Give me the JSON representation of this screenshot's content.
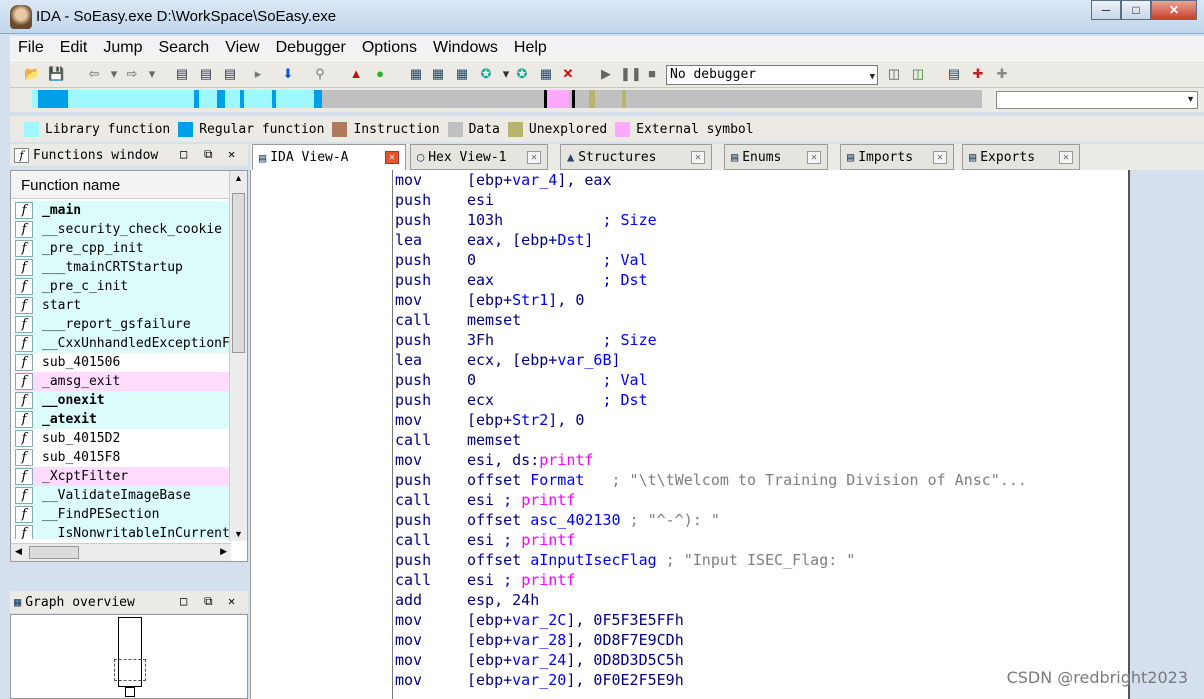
{
  "window": {
    "title": "IDA - SoEasy.exe D:\\WorkSpace\\SoEasy.exe"
  },
  "menu": [
    "File",
    "Edit",
    "Jump",
    "Search",
    "View",
    "Debugger",
    "Options",
    "Windows",
    "Help"
  ],
  "toolbar": {
    "debugger_value": "No debugger"
  },
  "legend": [
    {
      "label": "Library function",
      "color": "#9ff7ff"
    },
    {
      "label": "Regular function",
      "color": "#00a0e8"
    },
    {
      "label": "Instruction",
      "color": "#b07a5c"
    },
    {
      "label": "Data",
      "color": "#c0c0c0"
    },
    {
      "label": "Unexplored",
      "color": "#b8b46e"
    },
    {
      "label": "External symbol",
      "color": "#ffa8ff"
    }
  ],
  "functions_window": {
    "title": "Functions window",
    "column": "Function name",
    "items": [
      {
        "name": "_main",
        "bold": true,
        "bg": "#dcfcfc"
      },
      {
        "name": "__security_check_cookie",
        "bold": false,
        "bg": "#dcfcfc"
      },
      {
        "name": "_pre_cpp_init",
        "bold": false,
        "bg": "#dcfcfc"
      },
      {
        "name": "___tmainCRTStartup",
        "bold": false,
        "bg": "#dcfcfc"
      },
      {
        "name": "_pre_c_init",
        "bold": false,
        "bg": "#dcfcfc"
      },
      {
        "name": "start",
        "bold": false,
        "bg": "#dcfcfc"
      },
      {
        "name": "___report_gsfailure",
        "bold": false,
        "bg": "#dcfcfc"
      },
      {
        "name": "__CxxUnhandledExceptionFilter",
        "bold": false,
        "bg": "#dcfcfc"
      },
      {
        "name": "sub_401506",
        "bold": false,
        "bg": "#ffffff"
      },
      {
        "name": "_amsg_exit",
        "bold": false,
        "bg": "#ffdcff"
      },
      {
        "name": "__onexit",
        "bold": true,
        "bg": "#dcfcfc"
      },
      {
        "name": "_atexit",
        "bold": true,
        "bg": "#dcfcfc"
      },
      {
        "name": "sub_4015D2",
        "bold": false,
        "bg": "#ffffff"
      },
      {
        "name": "sub_4015F8",
        "bold": false,
        "bg": "#ffffff"
      },
      {
        "name": "_XcptFilter",
        "bold": false,
        "bg": "#ffdcff"
      },
      {
        "name": "__ValidateImageBase",
        "bold": false,
        "bg": "#dcfcfc"
      },
      {
        "name": "__FindPESection",
        "bold": false,
        "bg": "#dcfcfc"
      },
      {
        "name": "__IsNonwritableInCurrentImage",
        "bold": false,
        "bg": "#dcfcfc"
      }
    ]
  },
  "graph_overview": {
    "title": "Graph overview"
  },
  "tabs": [
    {
      "label": "IDA View-A",
      "active": true
    },
    {
      "label": "Hex View-1",
      "active": false
    },
    {
      "label": "Structures",
      "active": false
    },
    {
      "label": "Enums",
      "active": false
    },
    {
      "label": "Imports",
      "active": false
    },
    {
      "label": "Exports",
      "active": false
    }
  ],
  "disassembly": [
    {
      "mn": "mov",
      "op": [
        [
          "",
          "[ebp+"
        ],
        [
          "sym",
          "var_4"
        ],
        [
          "",
          "], eax"
        ]
      ]
    },
    {
      "mn": "push",
      "op": [
        [
          "",
          "esi"
        ]
      ]
    },
    {
      "mn": "push",
      "op": [
        [
          "",
          "103h           "
        ]
      ],
      "cm": "; Size"
    },
    {
      "mn": "lea",
      "op": [
        [
          "",
          "eax, [ebp+"
        ],
        [
          "sym",
          "Dst"
        ],
        [
          "",
          "]"
        ]
      ]
    },
    {
      "mn": "push",
      "op": [
        [
          "",
          "0              "
        ]
      ],
      "cm": "; Val"
    },
    {
      "mn": "push",
      "op": [
        [
          "",
          "eax            "
        ]
      ],
      "cm": "; Dst"
    },
    {
      "mn": "mov",
      "op": [
        [
          "",
          "[ebp+"
        ],
        [
          "sym",
          "Str1"
        ],
        [
          "",
          "], 0"
        ]
      ]
    },
    {
      "mn": "call",
      "op": [
        [
          "",
          "memset"
        ]
      ]
    },
    {
      "mn": "push",
      "op": [
        [
          "",
          "3Fh            "
        ]
      ],
      "cm": "; Size"
    },
    {
      "mn": "lea",
      "op": [
        [
          "",
          "ecx, [ebp+"
        ],
        [
          "sym",
          "var_6B"
        ],
        [
          "",
          "]"
        ]
      ]
    },
    {
      "mn": "push",
      "op": [
        [
          "",
          "0              "
        ]
      ],
      "cm": "; Val"
    },
    {
      "mn": "push",
      "op": [
        [
          "",
          "ecx            "
        ]
      ],
      "cm": "; Dst"
    },
    {
      "mn": "mov",
      "op": [
        [
          "",
          "[ebp+"
        ],
        [
          "sym",
          "Str2"
        ],
        [
          "",
          "], 0"
        ]
      ]
    },
    {
      "mn": "call",
      "op": [
        [
          "",
          "memset"
        ]
      ]
    },
    {
      "mn": "mov",
      "op": [
        [
          "",
          "esi, ds:"
        ],
        [
          "imp",
          "printf"
        ]
      ]
    },
    {
      "mn": "push",
      "op": [
        [
          "",
          "offset "
        ],
        [
          "sym",
          "Format"
        ],
        [
          "",
          "   "
        ]
      ],
      "cmstr": "; \"\\t\\tWelcom to Training Division of Ansc\"..."
    },
    {
      "mn": "call",
      "op": [
        [
          "",
          "esi "
        ],
        [
          "cm",
          "; "
        ],
        [
          "imp",
          "printf"
        ]
      ]
    },
    {
      "mn": "push",
      "op": [
        [
          "",
          "offset "
        ],
        [
          "sym",
          "asc_402130"
        ],
        [
          "",
          " "
        ]
      ],
      "cmstr": "; \"^-^): \""
    },
    {
      "mn": "call",
      "op": [
        [
          "",
          "esi "
        ],
        [
          "cm",
          "; "
        ],
        [
          "imp",
          "printf"
        ]
      ]
    },
    {
      "mn": "push",
      "op": [
        [
          "",
          "offset "
        ],
        [
          "sym",
          "aInputIsecFlag"
        ],
        [
          "",
          " "
        ]
      ],
      "cmstr": "; \"Input ISEC_Flag: \""
    },
    {
      "mn": "call",
      "op": [
        [
          "",
          "esi "
        ],
        [
          "cm",
          "; "
        ],
        [
          "imp",
          "printf"
        ]
      ]
    },
    {
      "mn": "add",
      "op": [
        [
          "",
          "esp, 24h"
        ]
      ]
    },
    {
      "mn": "mov",
      "op": [
        [
          "",
          "[ebp+"
        ],
        [
          "sym",
          "var_2C"
        ],
        [
          "",
          "], 0F5F3E5FFh"
        ]
      ]
    },
    {
      "mn": "mov",
      "op": [
        [
          "",
          "[ebp+"
        ],
        [
          "sym",
          "var_28"
        ],
        [
          "",
          "], 0D8F7E9CDh"
        ]
      ]
    },
    {
      "mn": "mov",
      "op": [
        [
          "",
          "[ebp+"
        ],
        [
          "sym",
          "var_24"
        ],
        [
          "",
          "], 0D8D3D5C5h"
        ]
      ]
    },
    {
      "mn": "mov",
      "op": [
        [
          "",
          "[ebp+"
        ],
        [
          "sym",
          "var_20"
        ],
        [
          "",
          "], 0F0E2F5E9h"
        ]
      ]
    }
  ],
  "watermark": "CSDN @redbright2023"
}
